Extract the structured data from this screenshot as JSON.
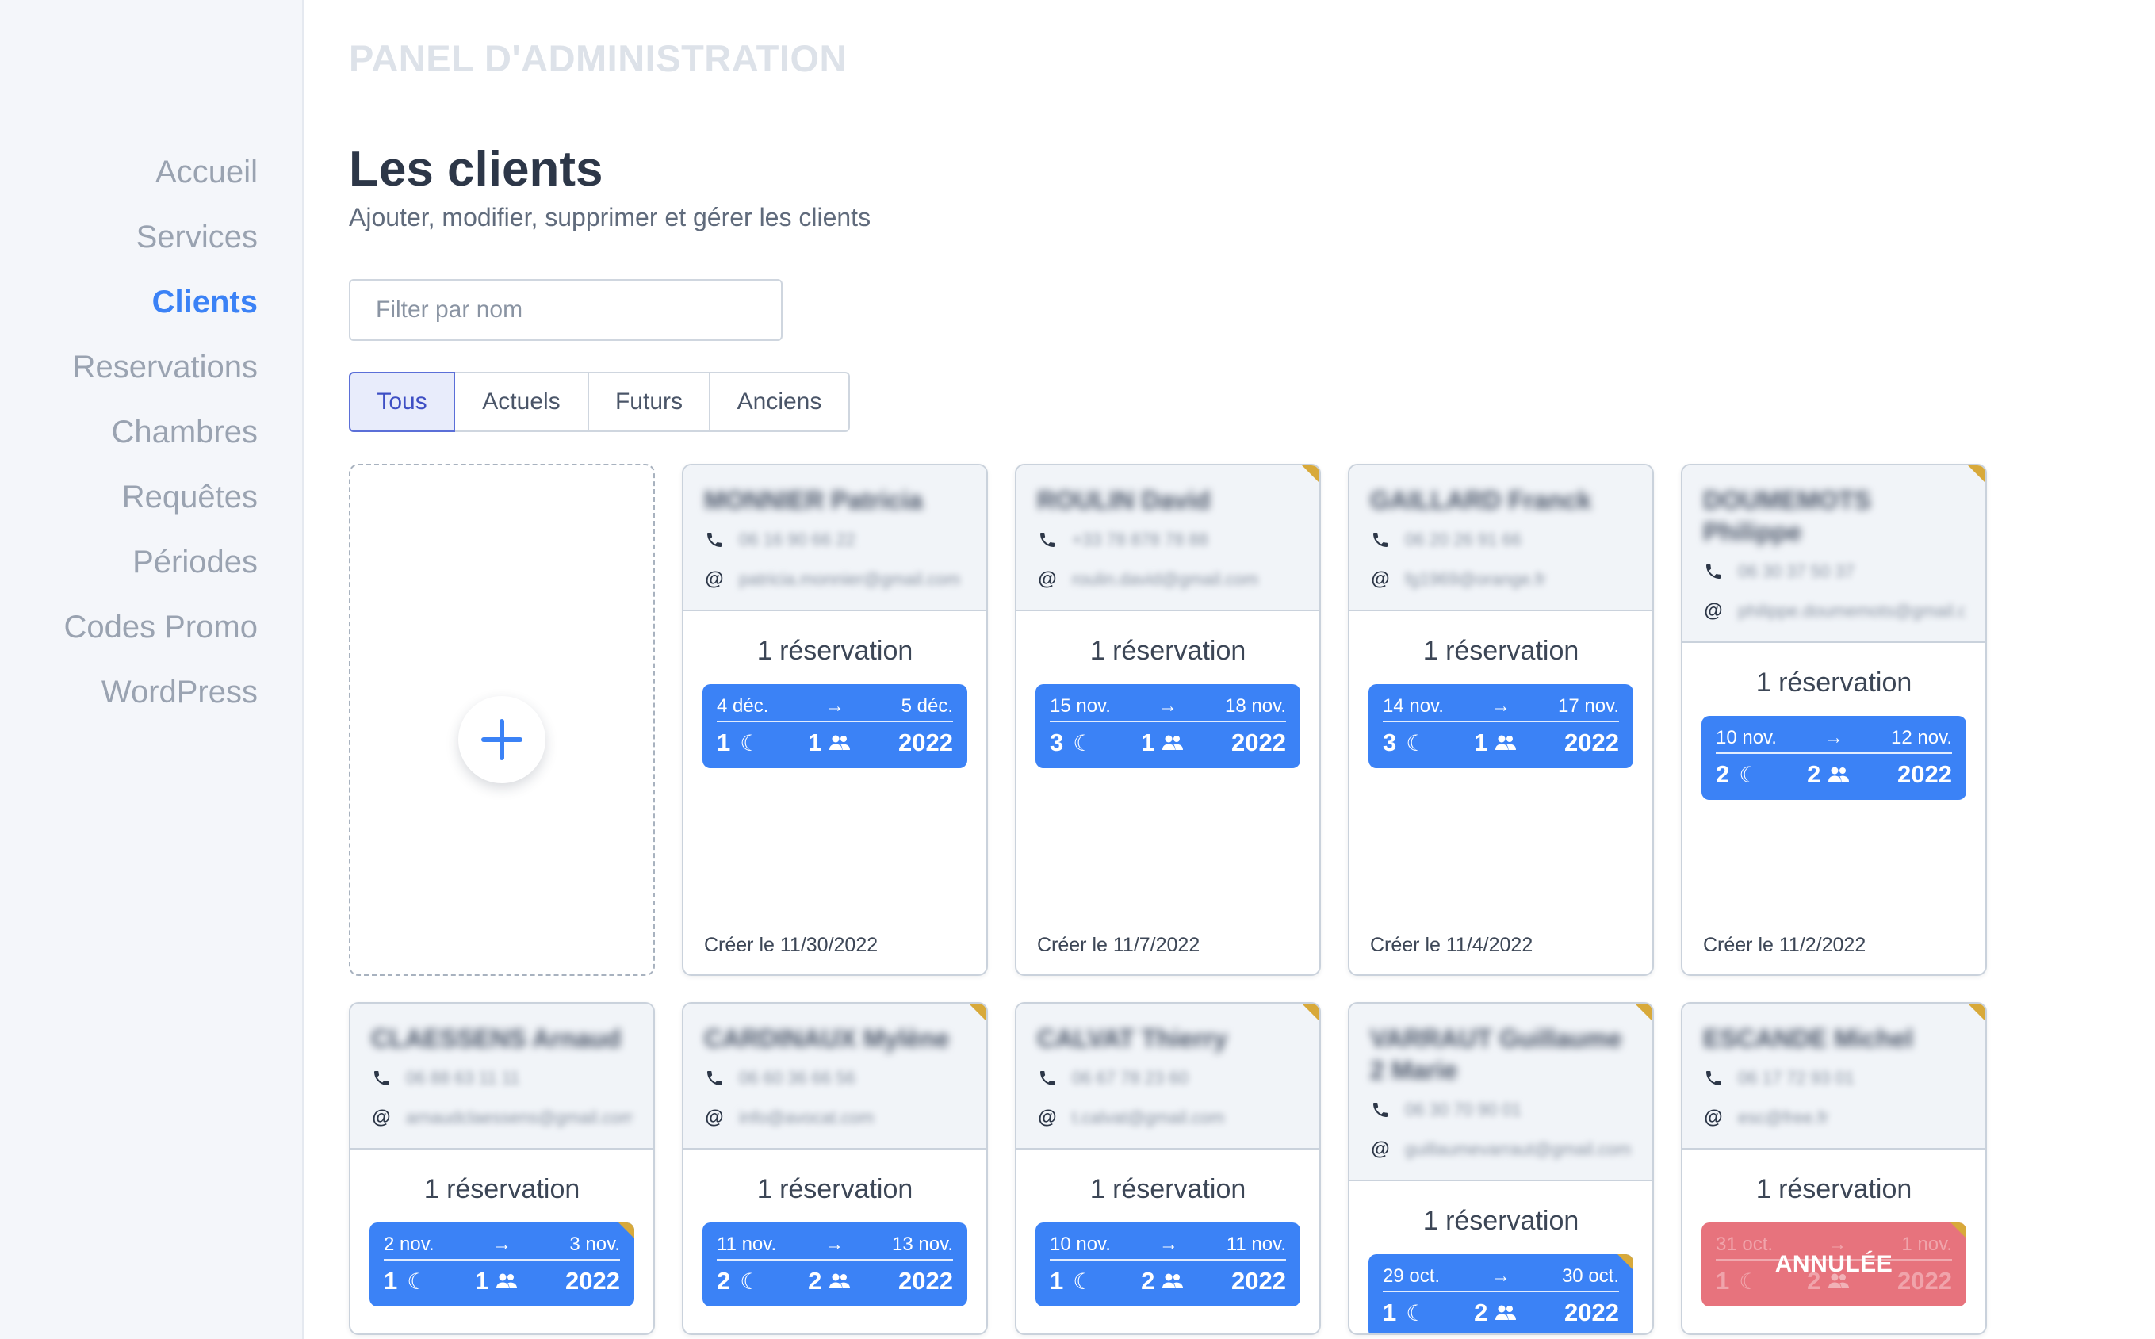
{
  "sidebar": {
    "items": [
      {
        "label": "Accueil",
        "active": false
      },
      {
        "label": "Services",
        "active": false
      },
      {
        "label": "Clients",
        "active": true
      },
      {
        "label": "Reservations",
        "active": false
      },
      {
        "label": "Chambres",
        "active": false
      },
      {
        "label": "Requêtes",
        "active": false
      },
      {
        "label": "Périodes",
        "active": false
      },
      {
        "label": "Codes Promo",
        "active": false
      },
      {
        "label": "WordPress",
        "active": false
      }
    ]
  },
  "header": {
    "panel_title": "PANEL D'ADMINISTRATION",
    "title": "Les clients",
    "subtitle": "Ajouter, modifier, supprimer et gérer les clients"
  },
  "filter": {
    "placeholder": "Filter par nom",
    "value": ""
  },
  "tabs": [
    {
      "label": "Tous",
      "active": true
    },
    {
      "label": "Actuels",
      "active": false
    },
    {
      "label": "Futurs",
      "active": false
    },
    {
      "label": "Anciens",
      "active": false
    }
  ],
  "icons": {
    "add": "plus-icon",
    "phone": "phone-icon",
    "email": "at-icon",
    "nights": "moon-icon",
    "guests": "people-icon",
    "arrow": "arrow-right-icon"
  },
  "colors": {
    "accent": "#3b82f6",
    "cancelled": "#e7737d",
    "flag": "#d8a93a"
  },
  "clients": [
    {
      "name": "MONNIER Patricia",
      "phone": "06 16 90 66 22",
      "email": "patricia.monnier@gmail.com",
      "flag": false,
      "reservations": "1 réservation",
      "reservation": {
        "from": "4 déc.",
        "arrow": "→",
        "to": "5 déc.",
        "nights": "1",
        "guests": "1",
        "year": "2022",
        "cancelled": false,
        "flag": false
      },
      "created": "Créer le 11/30/2022"
    },
    {
      "name": "ROULIN David",
      "phone": "+33 78 878 78 88",
      "email": "roulin.david@gmail.com",
      "flag": true,
      "reservations": "1 réservation",
      "reservation": {
        "from": "15 nov.",
        "arrow": "→",
        "to": "18 nov.",
        "nights": "3",
        "guests": "1",
        "year": "2022",
        "cancelled": false,
        "flag": false
      },
      "created": "Créer le 11/7/2022"
    },
    {
      "name": "GAILLARD Franck",
      "phone": "06 20 26 91 66",
      "email": "fg1969@orange.fr",
      "flag": false,
      "reservations": "1 réservation",
      "reservation": {
        "from": "14 nov.",
        "arrow": "→",
        "to": "17 nov.",
        "nights": "3",
        "guests": "1",
        "year": "2022",
        "cancelled": false,
        "flag": false
      },
      "created": "Créer le 11/4/2022"
    },
    {
      "name": "DOUMEMOTS Philippe",
      "phone": "06 30 37 50 37",
      "email": "philippe.doumemots@gmail.com",
      "flag": true,
      "reservations": "1 réservation",
      "reservation": {
        "from": "10 nov.",
        "arrow": "→",
        "to": "12 nov.",
        "nights": "2",
        "guests": "2",
        "year": "2022",
        "cancelled": false,
        "flag": false
      },
      "created": "Créer le 11/2/2022"
    },
    {
      "name": "CLAESSENS Arnaud",
      "phone": "06 88 63 11 11",
      "email": "arnaudclaessens@gmail.com",
      "flag": false,
      "reservations": "1 réservation",
      "reservation": {
        "from": "2 nov.",
        "arrow": "→",
        "to": "3 nov.",
        "nights": "1",
        "guests": "1",
        "year": "2022",
        "cancelled": false,
        "flag": true
      },
      "created": ""
    },
    {
      "name": "CARDINAUX Mylène",
      "phone": "06 60 36 66 56",
      "email": "info@avocat.com",
      "flag": true,
      "reservations": "1 réservation",
      "reservation": {
        "from": "11 nov.",
        "arrow": "→",
        "to": "13 nov.",
        "nights": "2",
        "guests": "2",
        "year": "2022",
        "cancelled": false,
        "flag": false
      },
      "created": ""
    },
    {
      "name": "CALVAT Thierry",
      "phone": "06 67 78 23 60",
      "email": "t.calvat@gmail.com",
      "flag": true,
      "reservations": "1 réservation",
      "reservation": {
        "from": "10 nov.",
        "arrow": "→",
        "to": "11 nov.",
        "nights": "1",
        "guests": "2",
        "year": "2022",
        "cancelled": false,
        "flag": false
      },
      "created": ""
    },
    {
      "name": "VARRAUT Guillaume 2 Marie",
      "phone": "06 30 70 90 01",
      "email": "guillaumevarraut@gmail.com",
      "flag": true,
      "reservations": "1 réservation",
      "reservation": {
        "from": "29 oct.",
        "arrow": "→",
        "to": "30 oct.",
        "nights": "1",
        "guests": "2",
        "year": "2022",
        "cancelled": false,
        "flag": true
      },
      "created": ""
    },
    {
      "name": "ESCANDE Michel",
      "phone": "06 17 72 93 01",
      "email": "esc@free.fr",
      "flag": true,
      "reservations": "1 réservation",
      "reservation": {
        "from": "31 oct.",
        "arrow": "→",
        "to": "1 nov.",
        "nights": "1",
        "guests": "2",
        "year": "2022",
        "cancelled": true,
        "cancel_label": "ANNULÉE",
        "flag": true
      },
      "created": ""
    }
  ]
}
